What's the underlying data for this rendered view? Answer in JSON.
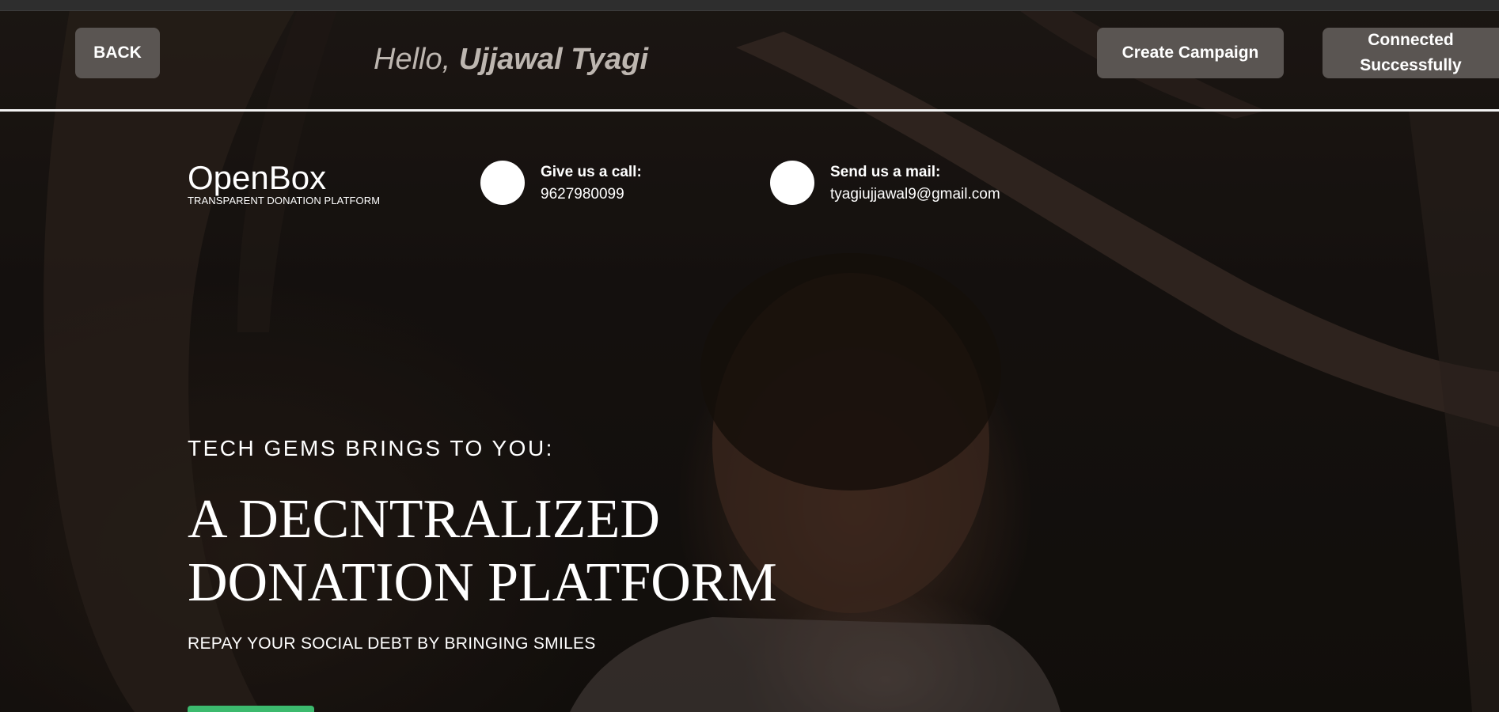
{
  "header": {
    "back_label": "BACK",
    "greeting_prefix": "Hello, ",
    "user_name": "Ujjawal Tyagi",
    "create_campaign_label": "Create Campaign",
    "connected_label": "Connected Successfully"
  },
  "brand": {
    "name": "OpenBox",
    "tagline": "TRANSPARENT DONATION PLATFORM"
  },
  "contacts": [
    {
      "label": "Give us a call:",
      "value": "9627980099",
      "icon": "phone-icon"
    },
    {
      "label": "Send us a mail:",
      "value": "tyagiujjawal9@gmail.com",
      "icon": "mail-icon"
    }
  ],
  "hero": {
    "eyebrow": "TECH GEMS BRINGS TO YOU:",
    "title_line1": "A DECNTRALIZED",
    "title_line2": "DONATION PLATFORM",
    "subtitle": "REPAY YOUR SOCIAL DEBT BY BRINGING SMILES"
  },
  "colors": {
    "button_bg": "#5a5552",
    "cta_green": "#3cba6e",
    "text": "#ffffff"
  }
}
